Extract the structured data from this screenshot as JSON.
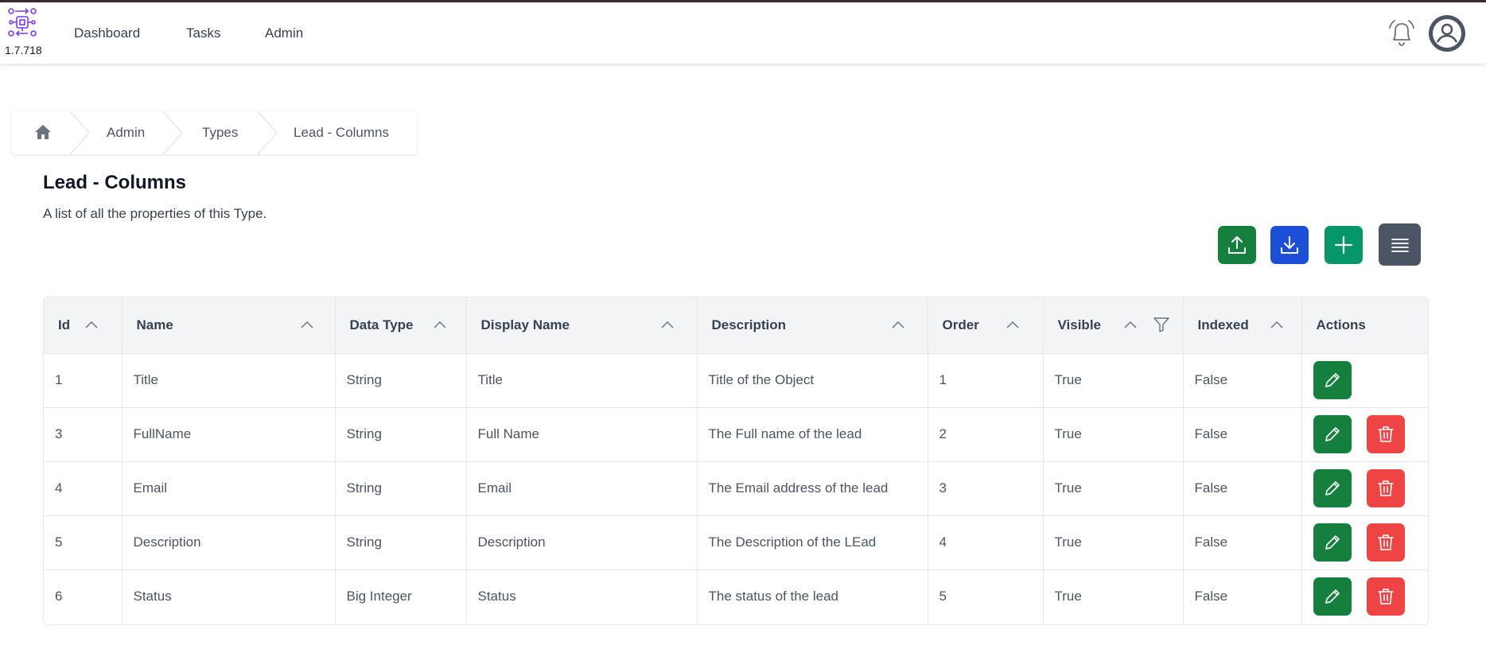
{
  "app": {
    "version": "1.7.718"
  },
  "nav": {
    "items": [
      "Dashboard",
      "Tasks",
      "Admin"
    ]
  },
  "icons": {
    "logo": "workflow-logo-icon",
    "notifications": "bell-icon",
    "profile": "user-avatar-icon",
    "home": "home-icon"
  },
  "breadcrumb": {
    "items": [
      "Admin",
      "Types",
      "Lead - Columns"
    ]
  },
  "page": {
    "title": "Lead - Columns",
    "description": "A list of all the properties of this Type."
  },
  "toolbar": {
    "buttons": [
      {
        "name": "upload",
        "icon": "upload-icon",
        "color": "#15803d"
      },
      {
        "name": "download",
        "icon": "download-icon",
        "color": "#1d4ed8"
      },
      {
        "name": "add",
        "icon": "plus-icon",
        "color": "#059669"
      },
      {
        "name": "columns",
        "icon": "list-icon",
        "color": "#4b5563"
      }
    ]
  },
  "table": {
    "columns": [
      "Id",
      "Name",
      "Data Type",
      "Display Name",
      "Description",
      "Order",
      "Visible",
      "Indexed",
      "Actions"
    ],
    "rows": [
      {
        "id": "1",
        "name": "Title",
        "data_type": "String",
        "display_name": "Title",
        "description": "Title of the Object",
        "order": "1",
        "visible": "True",
        "indexed": "False",
        "deletable": false
      },
      {
        "id": "3",
        "name": "FullName",
        "data_type": "String",
        "display_name": "Full Name",
        "description": "The Full name of the lead",
        "order": "2",
        "visible": "True",
        "indexed": "False",
        "deletable": true
      },
      {
        "id": "4",
        "name": "Email",
        "data_type": "String",
        "display_name": "Email",
        "description": "The Email address of the lead",
        "order": "3",
        "visible": "True",
        "indexed": "False",
        "deletable": true
      },
      {
        "id": "5",
        "name": "Description",
        "data_type": "String",
        "display_name": "Description",
        "description": "The Description of the LEad",
        "order": "4",
        "visible": "True",
        "indexed": "False",
        "deletable": true
      },
      {
        "id": "6",
        "name": "Status",
        "data_type": "Big Integer",
        "display_name": "Status",
        "description": "The status of the lead",
        "order": "5",
        "visible": "True",
        "indexed": "False",
        "deletable": true
      }
    ]
  }
}
